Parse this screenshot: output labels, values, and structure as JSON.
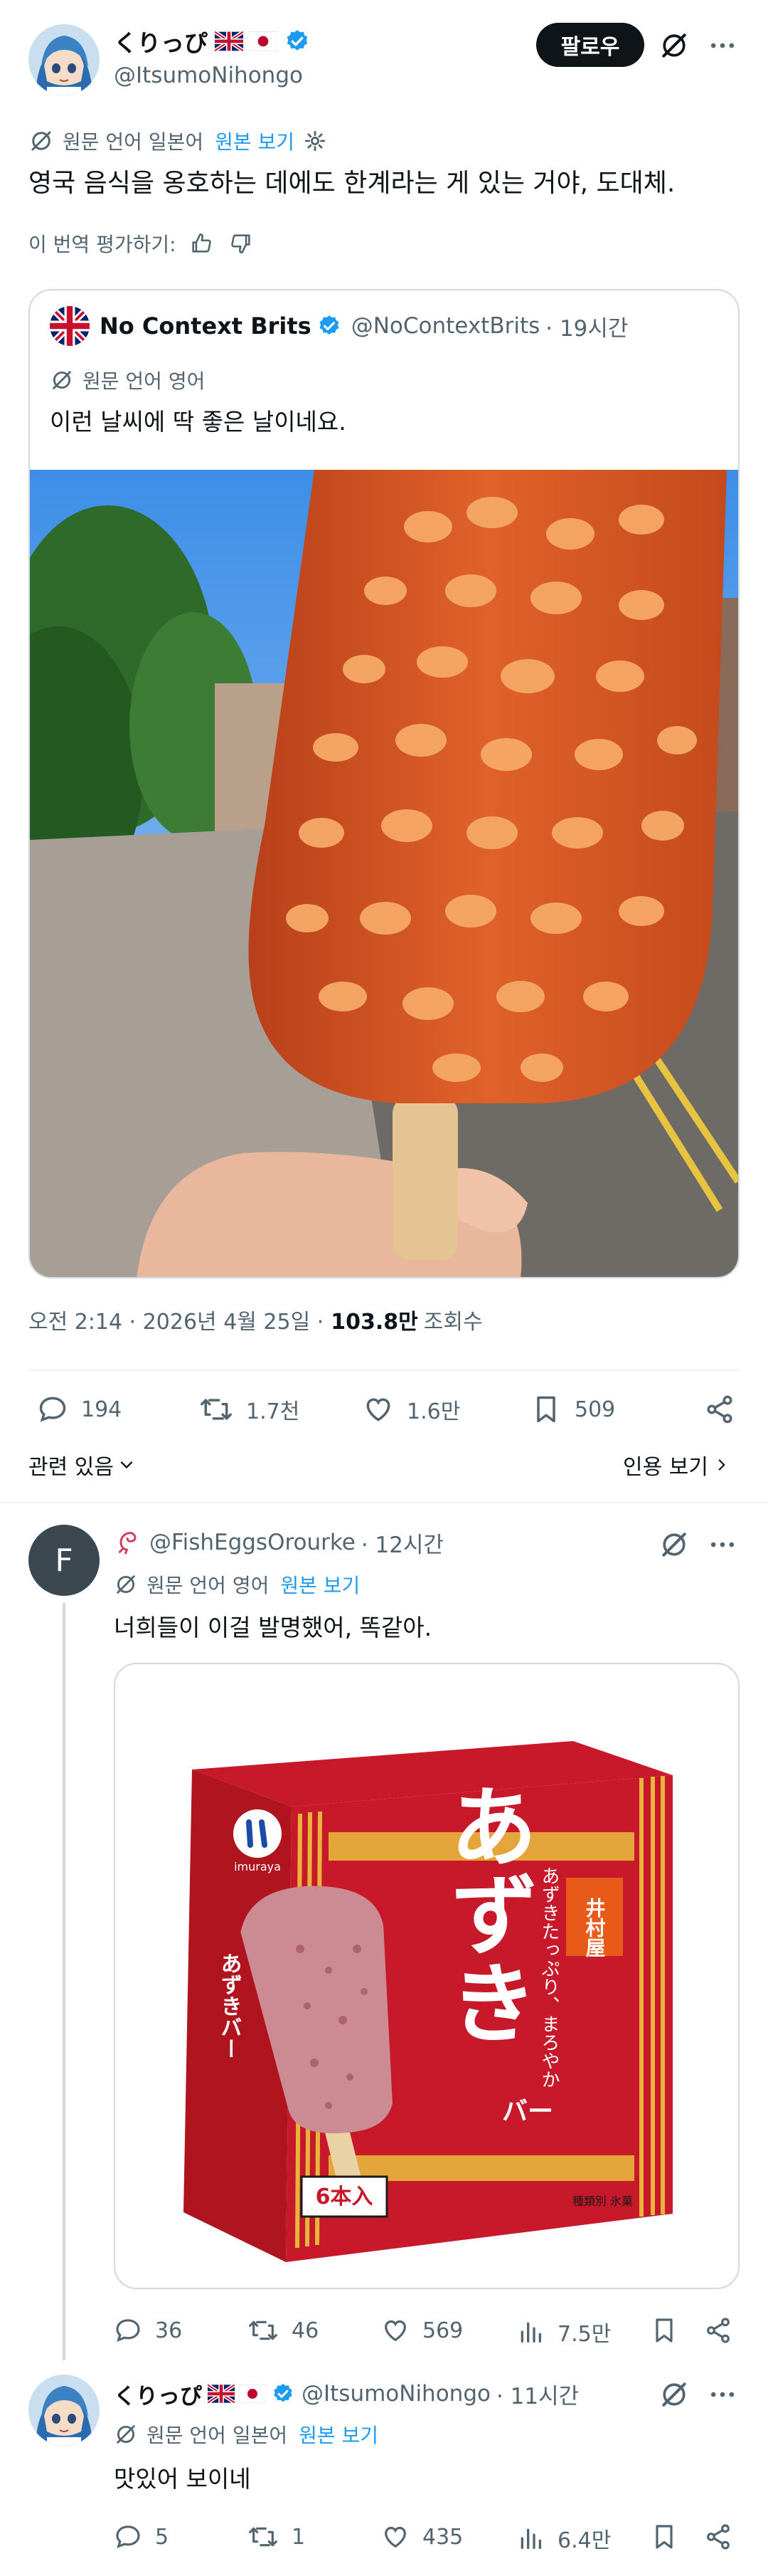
{
  "main_tweet": {
    "display_name": "くりっぴ",
    "handle": "@ItsumoNihongo",
    "follow_label": "팔로우",
    "translated_from": "원문 언어 일본어",
    "show_original": "원본 보기",
    "body": "영국 음식을 옹호하는 데에도 한계라는 게 있는 거야, 도대체.",
    "rate_translation": "이 번역 평가하기:",
    "timestamp": "오전 2:14 · 2026년 4월 25일 ·",
    "views_count": "103.8만",
    "views_label": "조회수",
    "stats": {
      "replies": "194",
      "retweets": "1.7천",
      "likes": "1.6만",
      "bookmarks": "509"
    },
    "related_label": "관련 있음",
    "view_quotes": "인용 보기"
  },
  "quoted_tweet": {
    "display_name": "No Context Brits",
    "handle": "@NoContextBrits",
    "time": "· 19시간",
    "translated_from": "원문 언어 영어",
    "body": "이런 날씨에 딱 좋은 날이네요."
  },
  "reply1": {
    "avatar_letter": "F",
    "handle": "@FishEggsOrourke",
    "time": "· 12시간",
    "translated_from": "원문 언어 영어",
    "show_original": "원본 보기",
    "body": "너희들이 이걸 발명했어, 똑같아.",
    "package": {
      "brand": "井村屋",
      "title": "あずき",
      "bar": "バー",
      "tagline": "あずきたっぷり、まろやか",
      "count": "6本入",
      "logo_text": "imuraya",
      "side_text": "あずきバー",
      "type_text": "種類別 氷菓"
    },
    "stats": {
      "replies": "36",
      "retweets": "46",
      "likes": "569",
      "views": "7.5만"
    }
  },
  "reply2": {
    "display_name": "くりっぴ",
    "handle": "@ItsumoNihongo",
    "time": "· 11시간",
    "translated_from": "원문 언어 일본어",
    "show_original": "원본 보기",
    "body": "맛있어 보이네",
    "stats": {
      "replies": "5",
      "retweets": "1",
      "likes": "435",
      "views": "6.4만"
    }
  },
  "colors": {
    "accent": "#1d9bf0",
    "text": "#0f1419",
    "secondary": "#536471",
    "border": "#cfd9de",
    "package_red": "#c8192b",
    "sauce": "#d9581e"
  }
}
